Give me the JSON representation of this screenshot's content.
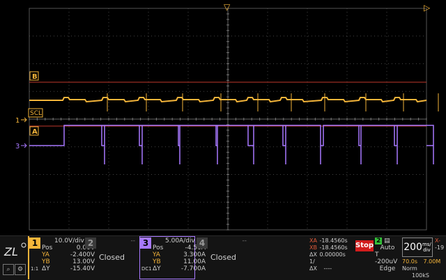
{
  "markers": {
    "top_trigger": "▽",
    "right_trigger": "▷",
    "cursor_b": "B",
    "cursor_a": "A",
    "scl_label": "SCL",
    "ch1_marker": "1",
    "ch3_marker": "3"
  },
  "colors": {
    "ch1": "#f5b53a",
    "ch3": "#a779ff",
    "cursor": "#c0392b",
    "grid": "#3a3a3a"
  },
  "ch1": {
    "number": "1",
    "scale": "10.0V/div",
    "pos_label": "Pos",
    "pos_value": "0.00V",
    "ya_label": "YA",
    "ya_value": "-2.400V",
    "yb_label": "YB",
    "yb_value": "13.00V",
    "dy_label": "ΔY",
    "dy_value": "-15.40V",
    "coupling": "1:1"
  },
  "ch2": {
    "number": "2",
    "dashes": "--",
    "status": "Closed"
  },
  "ch3": {
    "number": "3",
    "scale": "5.00A/div",
    "pos_label": "Pos",
    "pos_value": "-4.50A",
    "ya_label": "YA",
    "ya_value": "3.300A",
    "yb_label": "YB",
    "yb_value": "11.00A",
    "dy_label": "ΔY",
    "dy_value": "-7.700A",
    "coupling": "DC1"
  },
  "ch4": {
    "number": "4",
    "dashes": "--",
    "status": "Closed"
  },
  "measurements": {
    "xa_label": "XA",
    "xa_value": "-18.4560s",
    "xb_label": "XB",
    "xb_value": "-18.4560s",
    "dx_label": "ΔX",
    "dx_value": "0.00000s",
    "inv_dx_label": "1/ΔX",
    "inv_dx_value": "----"
  },
  "acquisition": {
    "stop_label": "Stop",
    "trigger_channel": "2",
    "mode": "Auto",
    "t_label": "T",
    "t_value": "-200uV",
    "edge_label": "Edge"
  },
  "timebase": {
    "value": "200",
    "unit_top": "ms/",
    "unit_bottom": "div",
    "x_label": "X-",
    "x_value": "-19",
    "delay": "70.0s",
    "record": "7.00M",
    "norm_label": "Norm",
    "sample_rate": "100kS"
  }
}
